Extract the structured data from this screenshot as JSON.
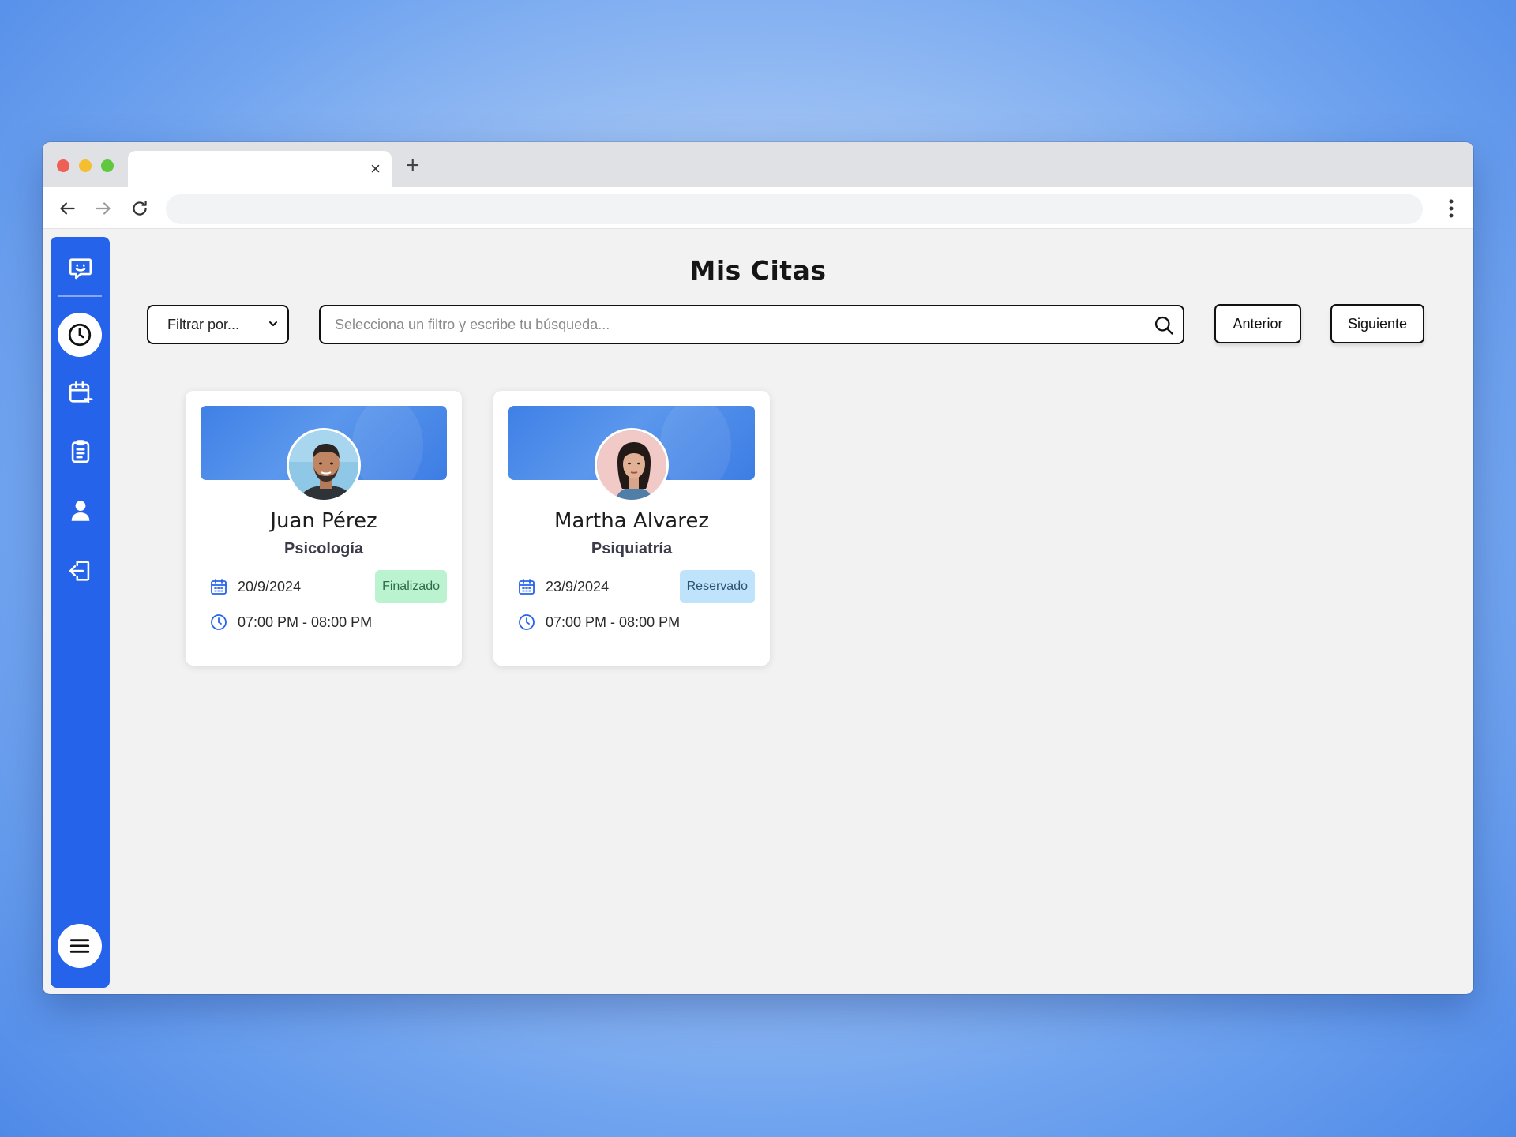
{
  "browser": {
    "tab_title": "",
    "tab_close_glyph": "×",
    "new_tab_glyph": "+",
    "url": ""
  },
  "sidebar": {
    "items": [
      {
        "name": "chat",
        "icon": "chat-smile-icon"
      },
      {
        "name": "appointments",
        "icon": "clock-icon",
        "active": true
      },
      {
        "name": "schedule",
        "icon": "calendar-plus-icon"
      },
      {
        "name": "records",
        "icon": "clipboard-icon"
      },
      {
        "name": "profile",
        "icon": "user-icon"
      },
      {
        "name": "logout",
        "icon": "logout-icon"
      }
    ],
    "menu_icon": "hamburger-menu-icon"
  },
  "page": {
    "title": "Mis Citas",
    "filter": {
      "selected": "Filtrar por..."
    },
    "search": {
      "placeholder": "Selecciona un filtro y escribe tu búsqueda...",
      "value": ""
    },
    "prev_label": "Anterior",
    "next_label": "Siguiente"
  },
  "appointments": [
    {
      "name": "Juan Pérez",
      "specialty": "Psicología",
      "date": "20/9/2024",
      "time": "07:00 PM - 08:00 PM",
      "status": "Finalizado"
    },
    {
      "name": "Martha Alvarez",
      "specialty": "Psiquiatría",
      "date": "23/9/2024",
      "time": "07:00 PM - 08:00 PM",
      "status": "Reservado"
    }
  ],
  "colors": {
    "sidebar": "#2563eb",
    "status_finalizado_bg": "#bbf2cf",
    "status_reservado_bg": "#bfe3fb",
    "accent": "#2563eb"
  }
}
